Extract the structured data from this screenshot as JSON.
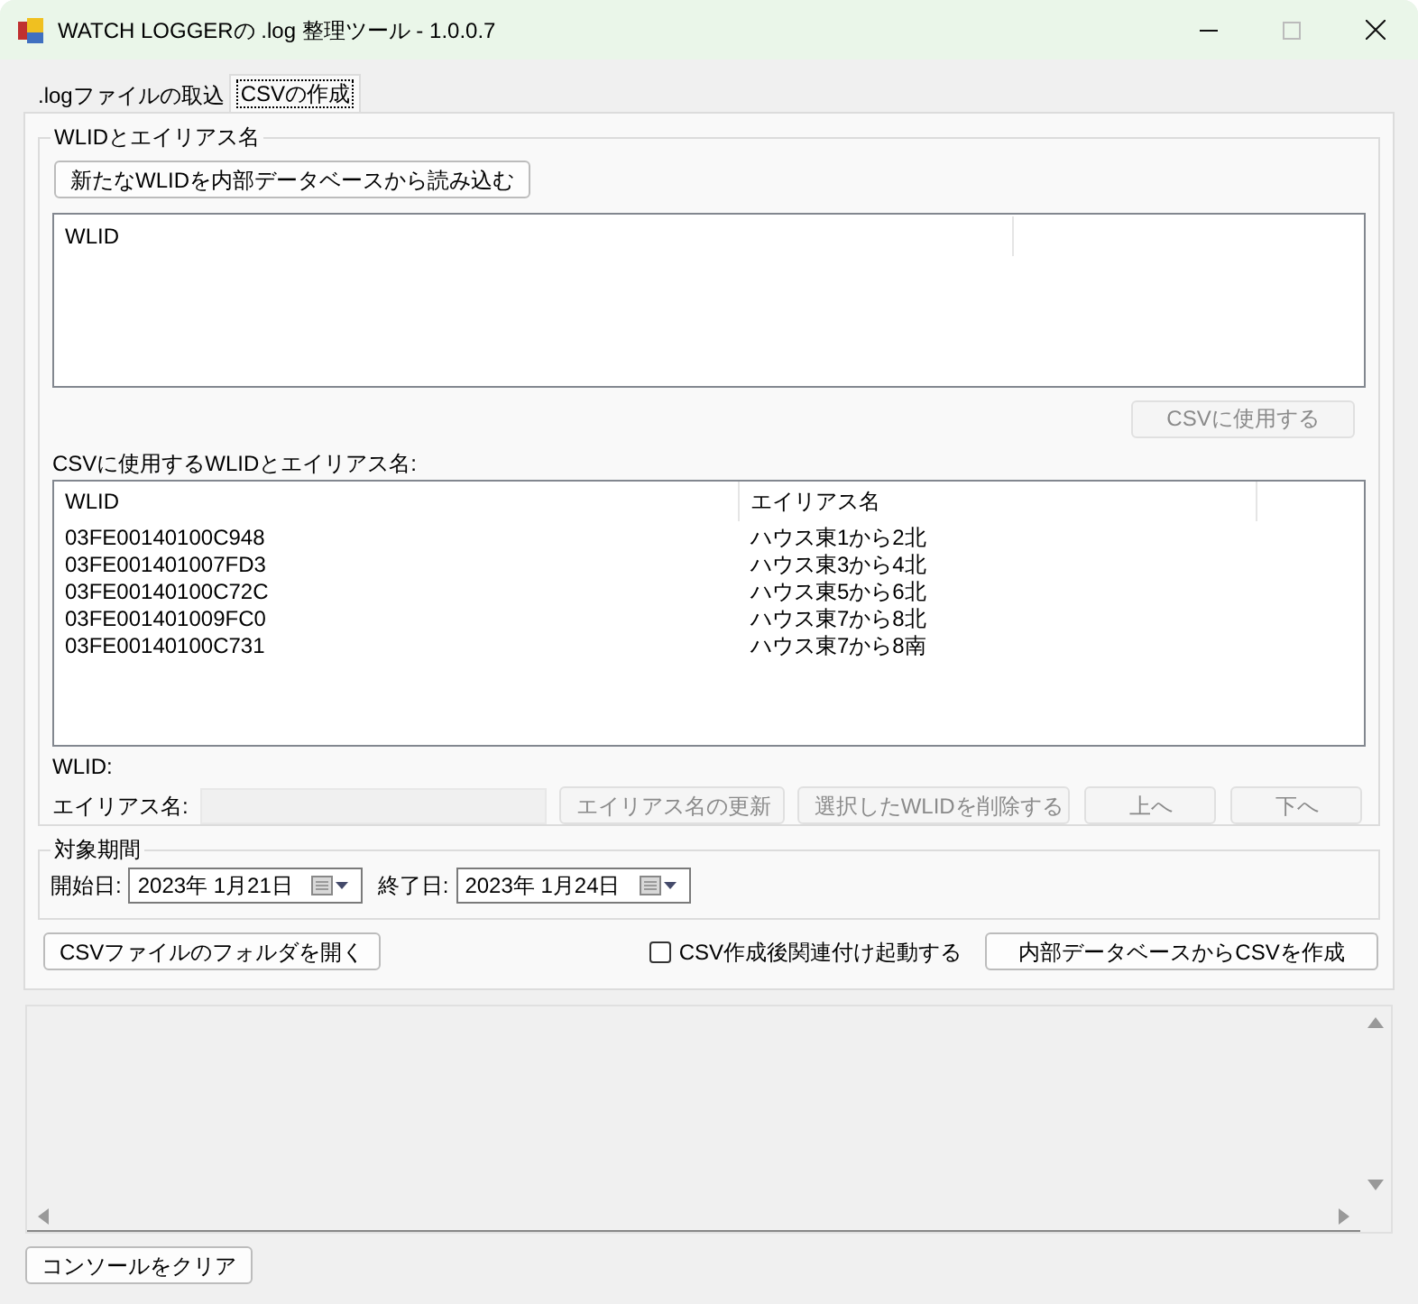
{
  "window": {
    "title": "WATCH LOGGERの .log 整理ツール - 1.0.0.7"
  },
  "tabs": [
    {
      "label": ".logファイルの取込",
      "selected": false
    },
    {
      "label": "CSVの作成",
      "selected": true
    }
  ],
  "wlid_group": {
    "title": "WLIDとエイリアス名",
    "load_button": {
      "label": "新たなWLIDを内部データベースから読み込む",
      "disabled": false
    },
    "source_list": {
      "columns": [
        "WLID"
      ]
    },
    "use_button": {
      "label": "CSVに使用する",
      "disabled": true
    },
    "selected_label": "CSVに使用するWLIDとエイリアス名:",
    "selected_list": {
      "columns": [
        "WLID",
        "エイリアス名"
      ],
      "rows": [
        [
          "03FE00140100C948",
          "ハウス東1から2北"
        ],
        [
          "03FE001401007FD3",
          "ハウス東3から4北"
        ],
        [
          "03FE00140100C72C",
          "ハウス東5から6北"
        ],
        [
          "03FE001401009FC0",
          "ハウス東7から8北"
        ],
        [
          "03FE00140100C731",
          "ハウス東7から8南"
        ]
      ]
    },
    "wlid_label": "WLID:",
    "alias_label": "エイリアス名:",
    "alias_field": {
      "disabled": true
    },
    "buttons": [
      {
        "label": "エイリアス名の更新",
        "disabled": true
      },
      {
        "label": "選択したWLIDを削除する",
        "disabled": true
      },
      {
        "label": "上へ",
        "disabled": true
      },
      {
        "label": "下へ",
        "disabled": true
      }
    ]
  },
  "period_group": {
    "title": "対象期間",
    "start": {
      "label": "開始日:",
      "value": "2023年  1月21日"
    },
    "end": {
      "label": "終了日:",
      "value": "2023年  1月24日"
    }
  },
  "open_folder_button": {
    "label": "CSVファイルのフォルダを開く",
    "disabled": false
  },
  "launch_checkbox": {
    "label": "CSV作成後関連付け起動する",
    "checked": false
  },
  "create_button": {
    "label": "内部データベースからCSVを作成",
    "disabled": false
  },
  "clear_console_button": {
    "label": "コンソールをクリア",
    "disabled": false
  }
}
